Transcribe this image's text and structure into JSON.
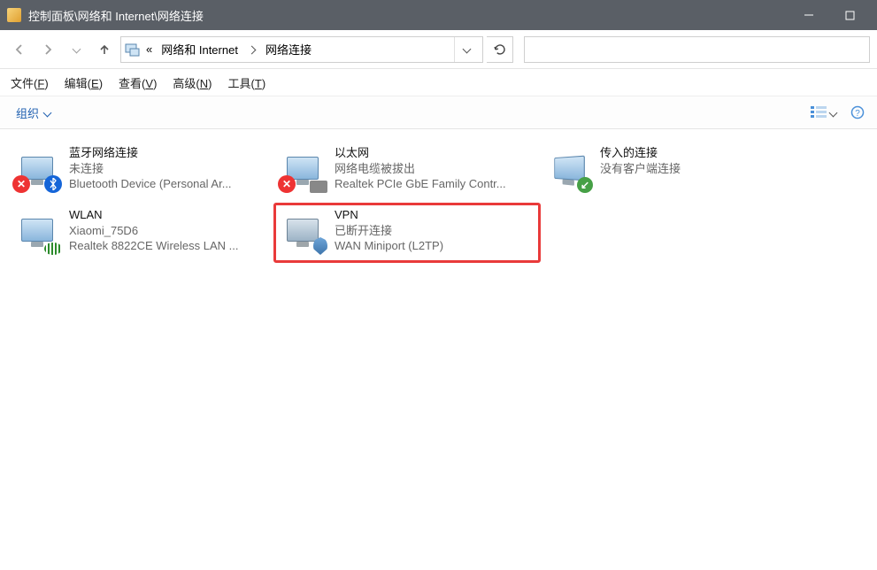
{
  "window": {
    "title": "控制面板\\网络和 Internet\\网络连接"
  },
  "breadcrumbs": {
    "prefix": "«",
    "items": [
      {
        "label": "网络和 Internet"
      },
      {
        "label": "网络连接"
      }
    ]
  },
  "menubar": {
    "file": {
      "label": "文件",
      "accel": "F"
    },
    "edit": {
      "label": "编辑",
      "accel": "E"
    },
    "view": {
      "label": "查看",
      "accel": "V"
    },
    "advanced": {
      "label": "高级",
      "accel": "N"
    },
    "tools": {
      "label": "工具",
      "accel": "T"
    }
  },
  "toolbar": {
    "organize_label": "组织"
  },
  "connections": [
    {
      "id": "bluetooth",
      "name": "蓝牙网络连接",
      "status": "未连接",
      "device": "Bluetooth Device (Personal Ar...",
      "icon": "bluetooth",
      "error": true,
      "highlighted": false
    },
    {
      "id": "ethernet",
      "name": "以太网",
      "status": "网络电缆被拔出",
      "device": "Realtek PCIe GbE Family Contr...",
      "icon": "ethernet",
      "error": true,
      "highlighted": false
    },
    {
      "id": "incoming",
      "name": "传入的连接",
      "status": "没有客户端连接",
      "device": "",
      "icon": "incoming",
      "error": false,
      "highlighted": false
    },
    {
      "id": "wlan",
      "name": "WLAN",
      "status": "Xiaomi_75D6",
      "device": "Realtek 8822CE Wireless LAN ...",
      "icon": "wifi",
      "error": false,
      "highlighted": false
    },
    {
      "id": "vpn",
      "name": "VPN",
      "status": "已断开连接",
      "device": "WAN Miniport (L2TP)",
      "icon": "vpn",
      "error": false,
      "highlighted": true
    }
  ]
}
